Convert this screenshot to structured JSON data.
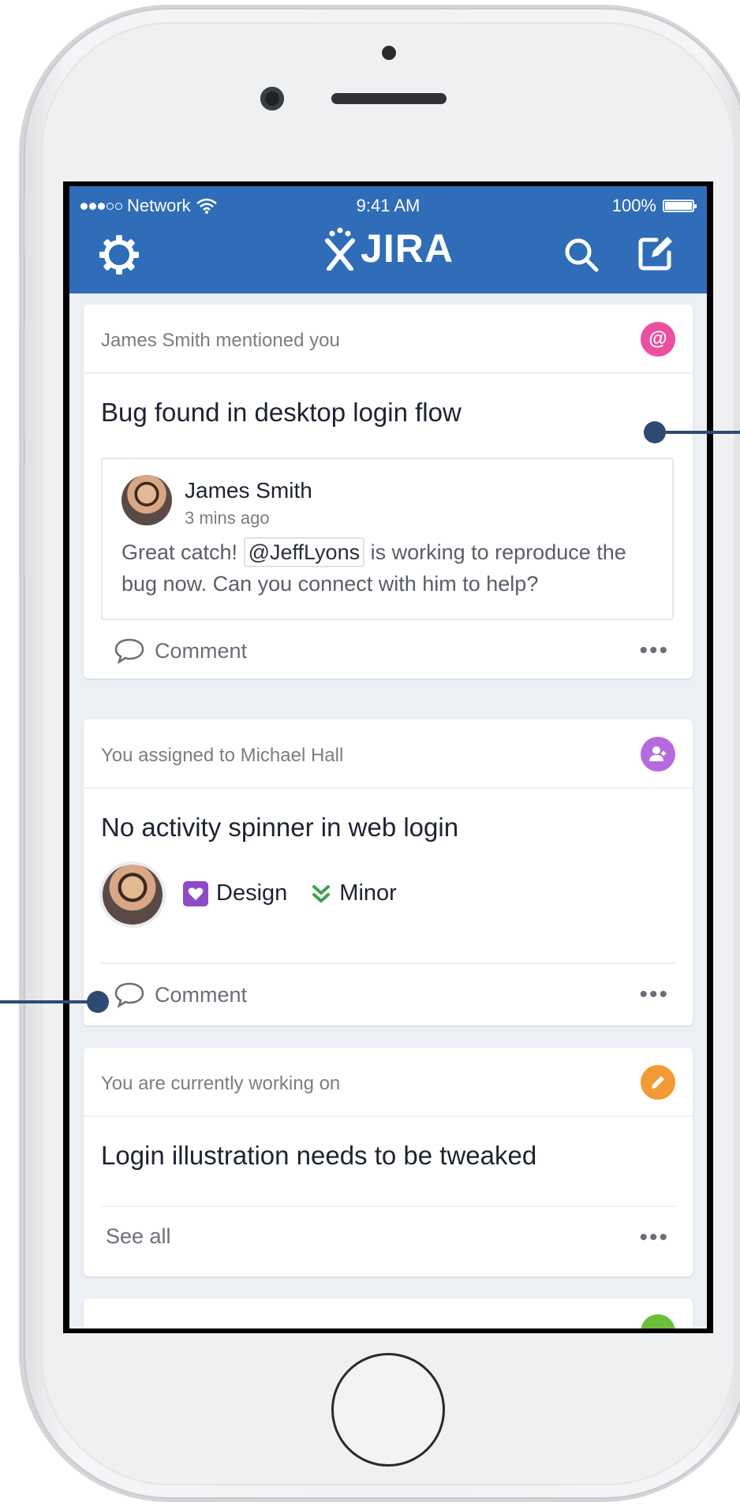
{
  "status_bar": {
    "carrier": "Network",
    "time": "9:41 AM",
    "battery": "100%"
  },
  "header": {
    "logo_text": "JIRA",
    "left_icon": "gear-icon",
    "right_icons": [
      "search-icon",
      "edit-icon"
    ],
    "bar_color": "#2f6db8"
  },
  "cards": [
    {
      "header": "James Smith mentioned you",
      "badge_icon": "mention-icon",
      "badge_color": "#ec4fa0",
      "title": "Bug found in desktop login flow",
      "comment": {
        "author": "James Smith",
        "time": "3 mins ago",
        "text_before": "Great catch!",
        "mention": "@JeffLyons",
        "text_after": "is working to reproduce the bug now. Can you connect with him to help?"
      },
      "action_label": "Comment",
      "more_label": "•••"
    },
    {
      "header": "You assigned to Michael Hall",
      "badge_icon": "assign-user-icon",
      "badge_color": "#b66ae0",
      "title": "No activity spinner in web login",
      "tags": {
        "type": "Design",
        "priority": "Minor"
      },
      "action_label": "Comment",
      "more_label": "•••"
    },
    {
      "header": "You are currently working on",
      "badge_icon": "pencil-icon",
      "badge_color": "#f39a35",
      "title": "Login illustration needs to be tweaked",
      "action_label": "See all",
      "more_label": "•••"
    }
  ],
  "colors": {
    "accent": "#2f6db8",
    "callout": "#2d4a73",
    "type_tag": "#8e4bc8",
    "priority_tag": "#3fa14a"
  }
}
